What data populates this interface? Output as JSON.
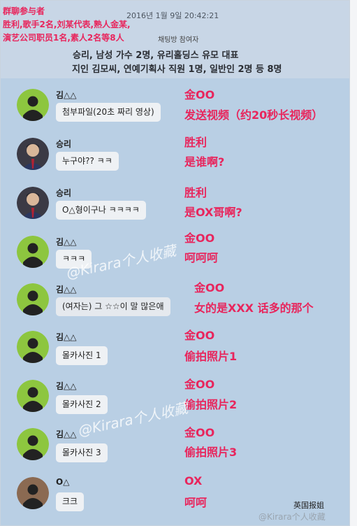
{
  "overlay": {
    "line1": "群聊参与者",
    "line2": "胜利,歌手2名,刘某代表,熟人金某,",
    "line3": "演艺公司职员1名,素人2名等8人"
  },
  "header": {
    "timestamp": "2016년 1월 9일 20:42:21",
    "room_label": "채팅방 참여자",
    "participants_line1": "승리, 남성 가수 2명, 유리홀딩스 유모 대표",
    "participants_line2": "지인 김모씨, 연예기획사 직원 1명, 일반인 2명 등 8명"
  },
  "messages": [
    {
      "name": "김△△",
      "text": "첨부파일(20초 짜리 영상)",
      "ann1": "金OO",
      "ann2": "发送视频（约20秒长视频）",
      "avatar": "default"
    },
    {
      "name": "승리",
      "text": "누구야?? ㅋㅋ",
      "ann1": "胜利",
      "ann2": "是谁啊?",
      "avatar": "photo"
    },
    {
      "name": "승리",
      "text": "O△형이구나 ㅋㅋㅋㅋ",
      "ann1": "胜利",
      "ann2": "是OX哥啊?",
      "avatar": "photo"
    },
    {
      "name": "김△△",
      "text": "ㅋㅋㅋ",
      "ann1": "金OO",
      "ann2": "呵呵呵",
      "avatar": "default"
    },
    {
      "name": "김△△",
      "text": "(여자는) 그 ☆☆이 말 많은애",
      "ann1": "金OO",
      "ann2": "女的是XXX 话多的那个",
      "avatar": "default"
    },
    {
      "name": "김△△",
      "text": "몰카사진 1",
      "ann1": "金OO",
      "ann2": "偷拍照片1",
      "avatar": "default"
    },
    {
      "name": "김△△",
      "text": "몰카사진 2",
      "ann1": "金OO",
      "ann2": "偷拍照片2",
      "avatar": "default"
    },
    {
      "name": "김△△",
      "text": "몰카사진 3",
      "ann1": "金OO",
      "ann2": "偷拍照片3",
      "avatar": "default"
    },
    {
      "name": "O△",
      "text": "크크",
      "ann1": "OX",
      "ann2": "呵呵",
      "avatar": "brown"
    }
  ],
  "watermarks": {
    "mid1": "@Kirara个人收藏",
    "mid2": "@Kirara个人收藏",
    "bottom": "@Kirara个人收藏",
    "logo": "英国报姐"
  },
  "colors": {
    "chat_bg": "#b9cfe4",
    "annotation": "#e8255c",
    "avatar_default": "#8dc63f",
    "avatar_brown": "#8b6a52"
  }
}
